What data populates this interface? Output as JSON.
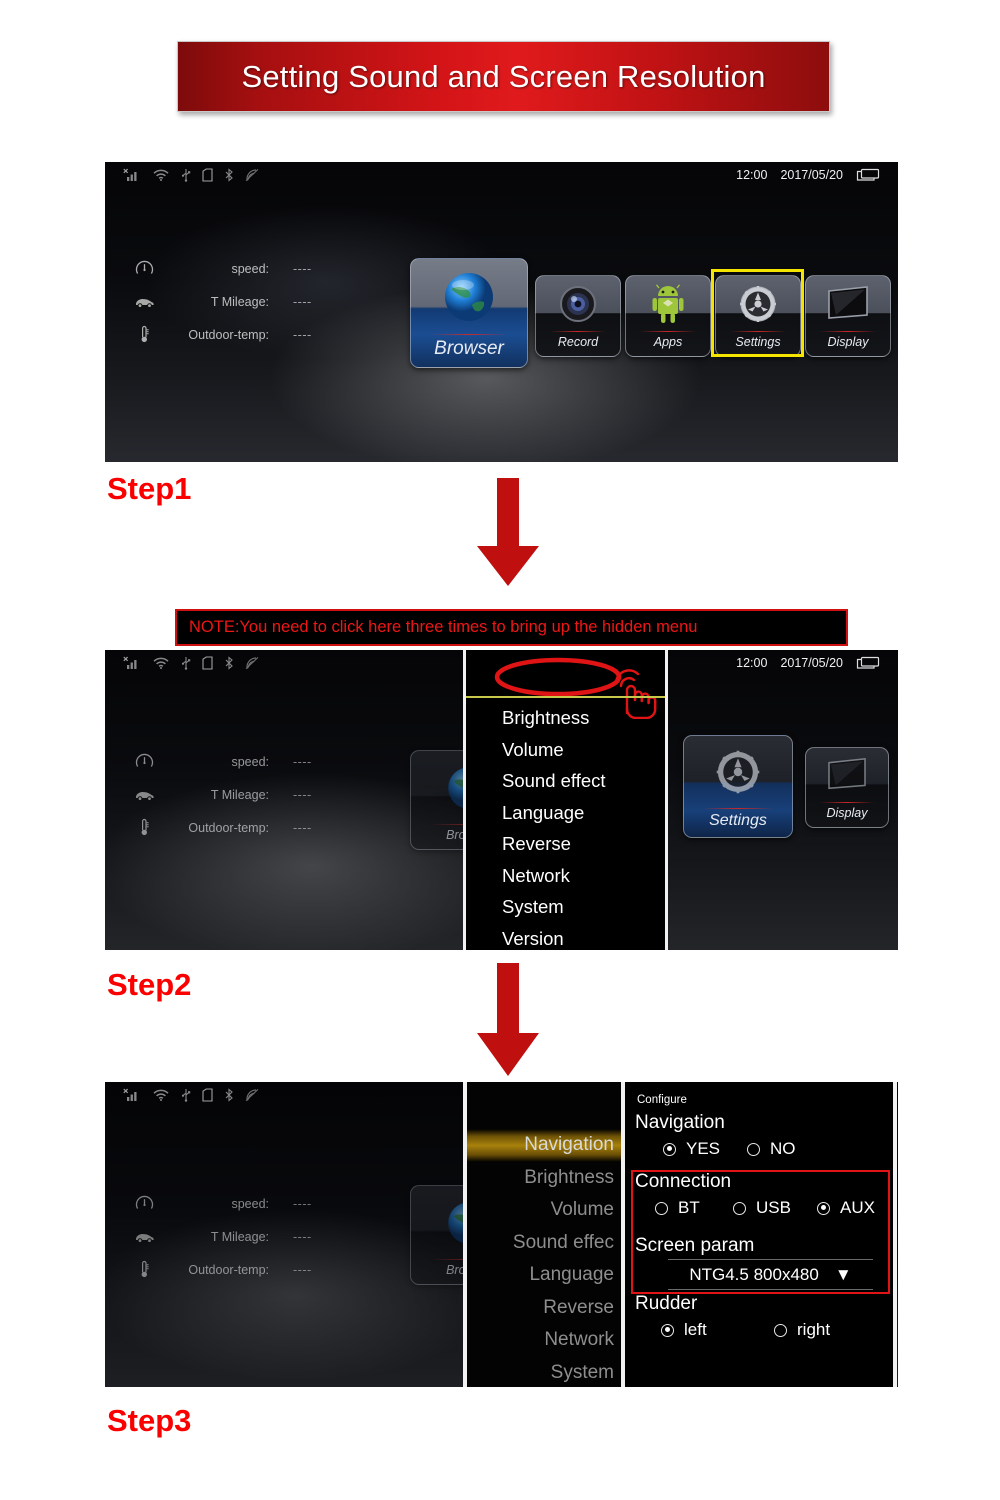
{
  "title": {
    "text": "Setting Sound and Screen Resolution"
  },
  "note": {
    "text": "NOTE:You need to click here three times to bring up the hidden menu"
  },
  "steps": {
    "step1": "Step1",
    "step2": "Step2",
    "step3": "Step3"
  },
  "statusbar": {
    "time": "12:00",
    "date": "2017/05/20",
    "icons": [
      "signal-off-icon",
      "wifi-icon",
      "usb-icon",
      "sdcard-icon",
      "bluetooth-icon",
      "cast-off-icon"
    ],
    "right_icon": "windows-icon"
  },
  "dashboard": {
    "rows": [
      {
        "icon": "speedometer-icon",
        "label": "speed:",
        "value": "----"
      },
      {
        "icon": "car-icon",
        "label": "T Mileage:",
        "value": "----"
      },
      {
        "icon": "thermometer-icon",
        "label": "Outdoor-temp:",
        "value": "----"
      }
    ]
  },
  "apps": [
    {
      "label": "Browser",
      "icon": "globe-icon"
    },
    {
      "label": "Record",
      "icon": "camera-lens-icon"
    },
    {
      "label": "Apps",
      "icon": "android-icon"
    },
    {
      "label": "Settings",
      "icon": "gear-icon"
    },
    {
      "label": "Display",
      "icon": "monitor-icon"
    }
  ],
  "hidden_menu": {
    "items": [
      "Brightness",
      "Volume",
      "Sound effect",
      "Language",
      "Reverse",
      "Network",
      "System",
      "Version"
    ],
    "tap_hint_icon": "hand-tap-icon",
    "highlight_icon": "red-ellipse-icon"
  },
  "step3_menu": {
    "items": [
      "Navigation",
      "Brightness",
      "Volume",
      "Sound effec",
      "Language",
      "Reverse",
      "Network",
      "System"
    ],
    "active": "Navigation"
  },
  "configure": {
    "caption": "Configure",
    "groups": [
      {
        "title": "Navigation",
        "options": [
          {
            "label": "YES",
            "selected": true
          },
          {
            "label": "NO",
            "selected": false
          }
        ]
      },
      {
        "title": "Connection",
        "options": [
          {
            "label": "BT",
            "selected": false
          },
          {
            "label": "USB",
            "selected": false
          },
          {
            "label": "AUX",
            "selected": true
          }
        ]
      },
      {
        "title": "Rudder",
        "options": [
          {
            "label": "left",
            "selected": true
          },
          {
            "label": "right",
            "selected": false
          }
        ]
      }
    ],
    "screen_param": {
      "title": "Screen param",
      "value": "NTG4.5  800x480",
      "caret": "▼"
    }
  },
  "colors": {
    "accent_red": "#c80f0f",
    "title_red": "#d31417",
    "step_red": "#fb0000",
    "highlight_yellow": "#f5e400",
    "menu_active_gold": "#a8820c"
  }
}
